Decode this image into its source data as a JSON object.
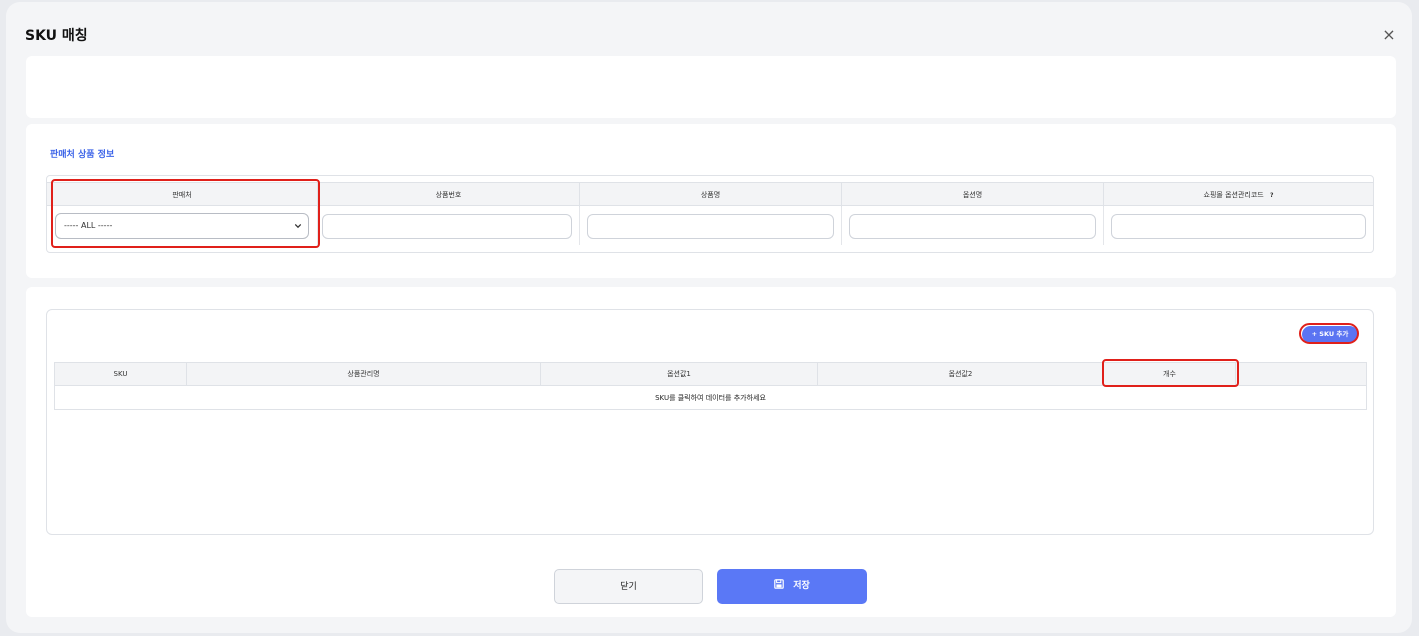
{
  "modal": {
    "title": "SKU 매칭",
    "close_glyph": "×"
  },
  "info_section": {
    "title": "판매처 상품 정보",
    "columns": [
      "판매처",
      "상품번호",
      "상품명",
      "옵션명",
      "쇼핑몰 옵션관리코드"
    ],
    "help_glyph": "?",
    "seller_select": {
      "selected": "----- ALL -----"
    }
  },
  "sku_section": {
    "add_button": "+ SKU 추가",
    "columns": [
      "SKU",
      "상품관리명",
      "옵션값1",
      "옵션값2",
      "개수"
    ],
    "empty_message": "SKU를 클릭하여 데이터를 추가하세요"
  },
  "footer": {
    "close_label": "닫기",
    "save_label": "저장"
  },
  "colors": {
    "accent": "#5a78f6",
    "section_title": "#3b63e8",
    "highlight": "#e0201a"
  },
  "icons": [
    "close-icon",
    "chevron-down-icon",
    "help-icon",
    "plus-icon",
    "save-icon"
  ]
}
